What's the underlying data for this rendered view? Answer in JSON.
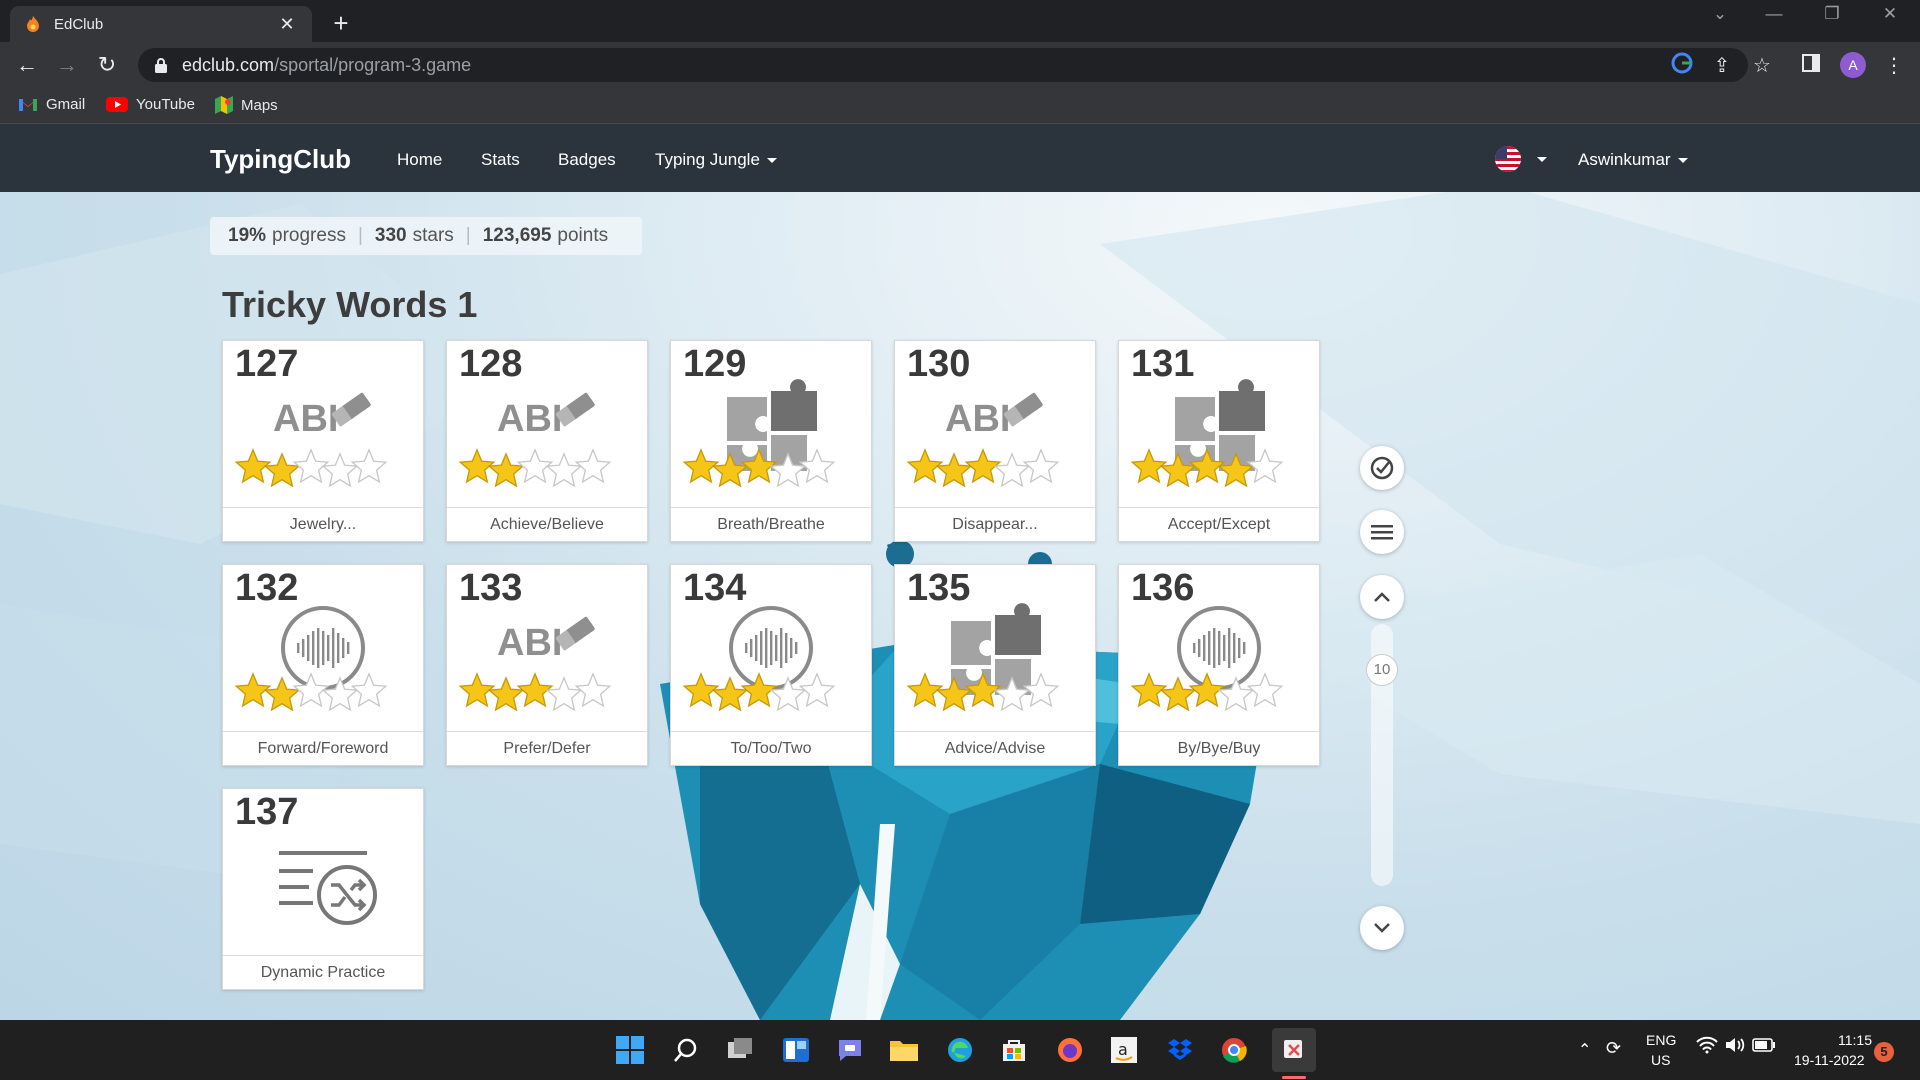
{
  "browser": {
    "tab_title": "EdClub",
    "url_host": "edclub.com",
    "url_path": "/sportal/program-3.game",
    "profile_initial": "A",
    "bookmarks": [
      "Gmail",
      "YouTube",
      "Maps"
    ]
  },
  "site": {
    "brand": "TypingClub",
    "nav": [
      "Home",
      "Stats",
      "Badges",
      "Typing Jungle"
    ],
    "user": "Aswinkumar"
  },
  "stats": {
    "progress_value": "19%",
    "progress_label": "progress",
    "stars_value": "330",
    "stars_label": "stars",
    "points_value": "123,695",
    "points_label": "points"
  },
  "section_title": "Tricky Words 1",
  "lessons": [
    {
      "num": "127",
      "label": "Jewelry...",
      "icon": "abc-eraser-icon",
      "stars": 2
    },
    {
      "num": "128",
      "label": "Achieve/Believe",
      "icon": "abc-eraser-icon",
      "stars": 2
    },
    {
      "num": "129",
      "label": "Breath/Breathe",
      "icon": "puzzle-icon",
      "stars": 3
    },
    {
      "num": "130",
      "label": "Disappear...",
      "icon": "abc-eraser-icon",
      "stars": 3
    },
    {
      "num": "131",
      "label": "Accept/Except",
      "icon": "puzzle-icon",
      "stars": 4
    },
    {
      "num": "132",
      "label": "Forward/Foreword",
      "icon": "audio-wave-icon",
      "stars": 2
    },
    {
      "num": "133",
      "label": "Prefer/Defer",
      "icon": "abc-eraser-icon",
      "stars": 3
    },
    {
      "num": "134",
      "label": "To/Too/Two",
      "icon": "audio-wave-icon",
      "stars": 3
    },
    {
      "num": "135",
      "label": "Advice/Advise",
      "icon": "puzzle-icon",
      "stars": 3
    },
    {
      "num": "136",
      "label": "By/Bye/Buy",
      "icon": "audio-wave-icon",
      "stars": 3
    },
    {
      "num": "137",
      "label": "Dynamic Practice",
      "icon": "dynamic-practice-icon",
      "stars": 0
    }
  ],
  "abc_text": "ABI",
  "scroll_level": "10",
  "taskbar": {
    "lang_1": "ENG",
    "lang_2": "US",
    "time": "11:15",
    "date": "19-11-2022",
    "notifications": "5"
  }
}
